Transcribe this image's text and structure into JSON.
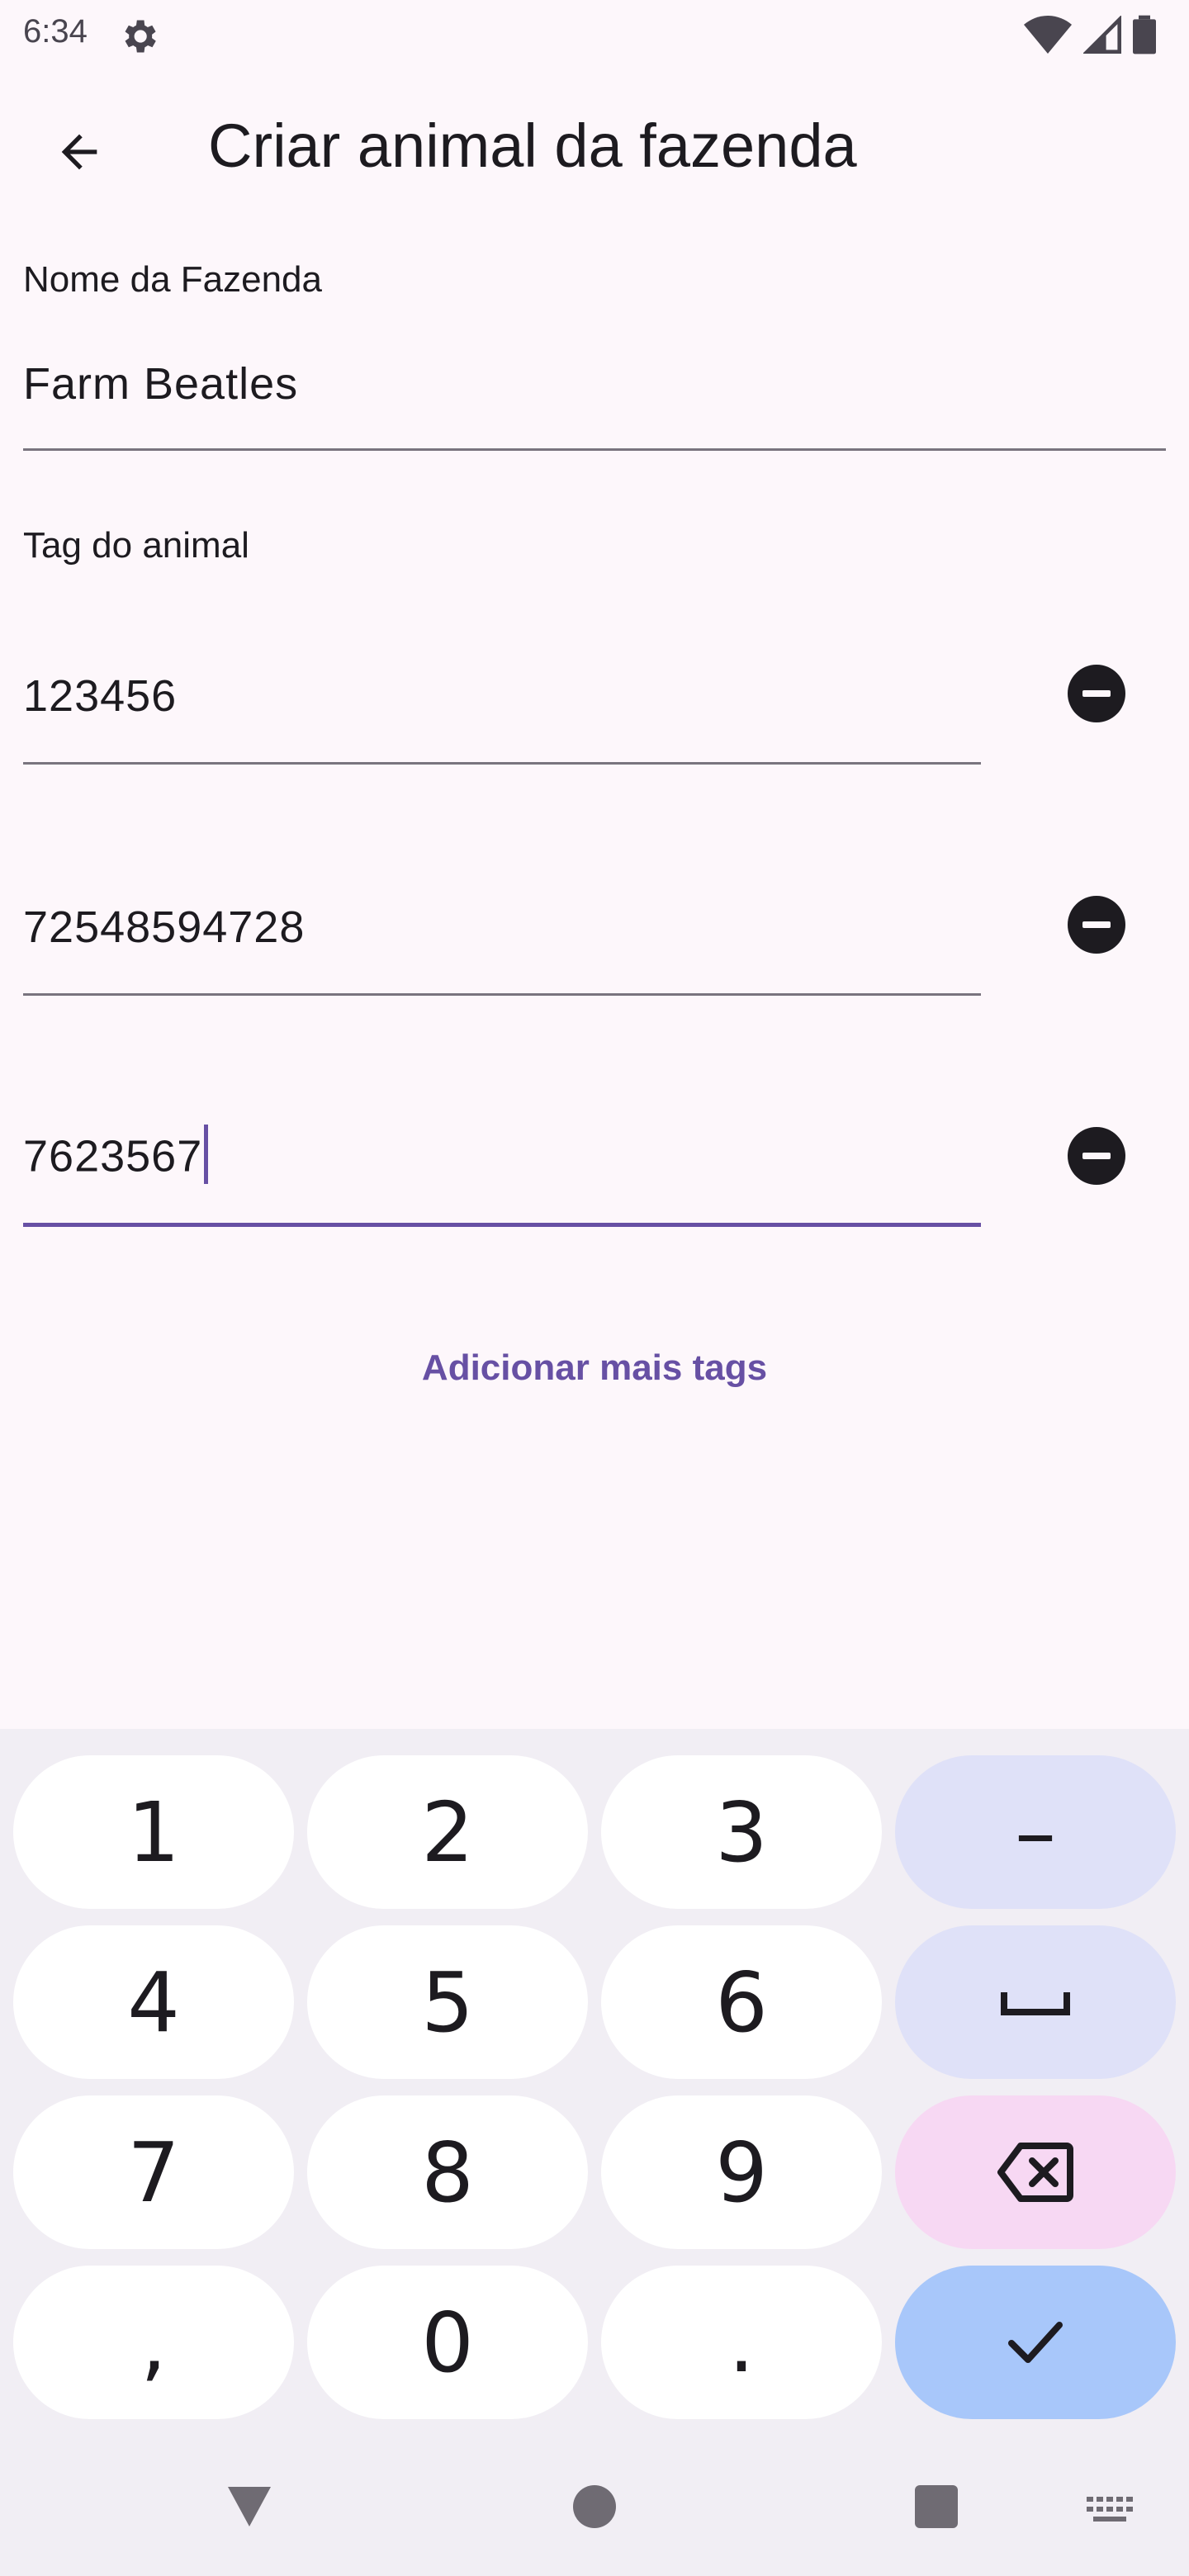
{
  "status_bar": {
    "time": "6:34"
  },
  "app_bar": {
    "title": "Criar animal da fazenda"
  },
  "farm": {
    "label": "Nome da Fazenda",
    "value": "Farm Beatles"
  },
  "tags": {
    "label": "Tag do animal",
    "items": [
      {
        "value": "123456",
        "focused": false
      },
      {
        "value": "72548594728",
        "focused": false
      },
      {
        "value": "7623567",
        "focused": true
      }
    ],
    "add_more": "Adicionar mais tags"
  },
  "keyboard": {
    "rows": [
      [
        "1",
        "2",
        "3",
        "–"
      ],
      [
        "4",
        "5",
        "6",
        "space-icon"
      ],
      [
        "7",
        "8",
        "9",
        "backspace-icon"
      ],
      [
        ",",
        "0",
        ".",
        "check-icon"
      ]
    ]
  },
  "colors": {
    "accent": "#6750a4",
    "background": "#fdf7fb",
    "keyboard_bg": "#f1eef4",
    "key_func": "#dfe1f8",
    "key_delete": "#f7d8f3",
    "key_done": "#a8c7fa"
  }
}
